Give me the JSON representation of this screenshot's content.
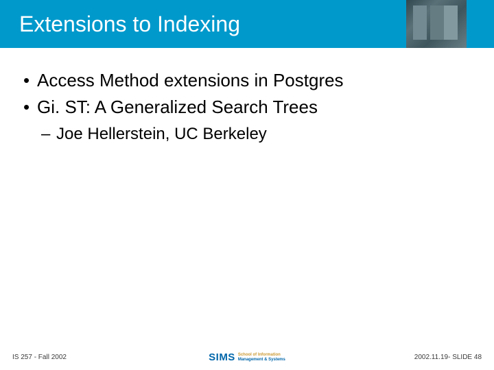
{
  "header": {
    "title": "Extensions to Indexing"
  },
  "bullets": {
    "item1": "Access Method extensions in Postgres",
    "item2": "Gi. ST: A Generalized Search Trees",
    "sub1": "Joe Hellerstein, UC Berkeley"
  },
  "footer": {
    "left": "IS 257 - Fall 2002",
    "right": "2002.11.19- SLIDE 48",
    "logo_main": "SIMS",
    "logo_line1": "School of Information",
    "logo_line2": "Management & Systems"
  }
}
